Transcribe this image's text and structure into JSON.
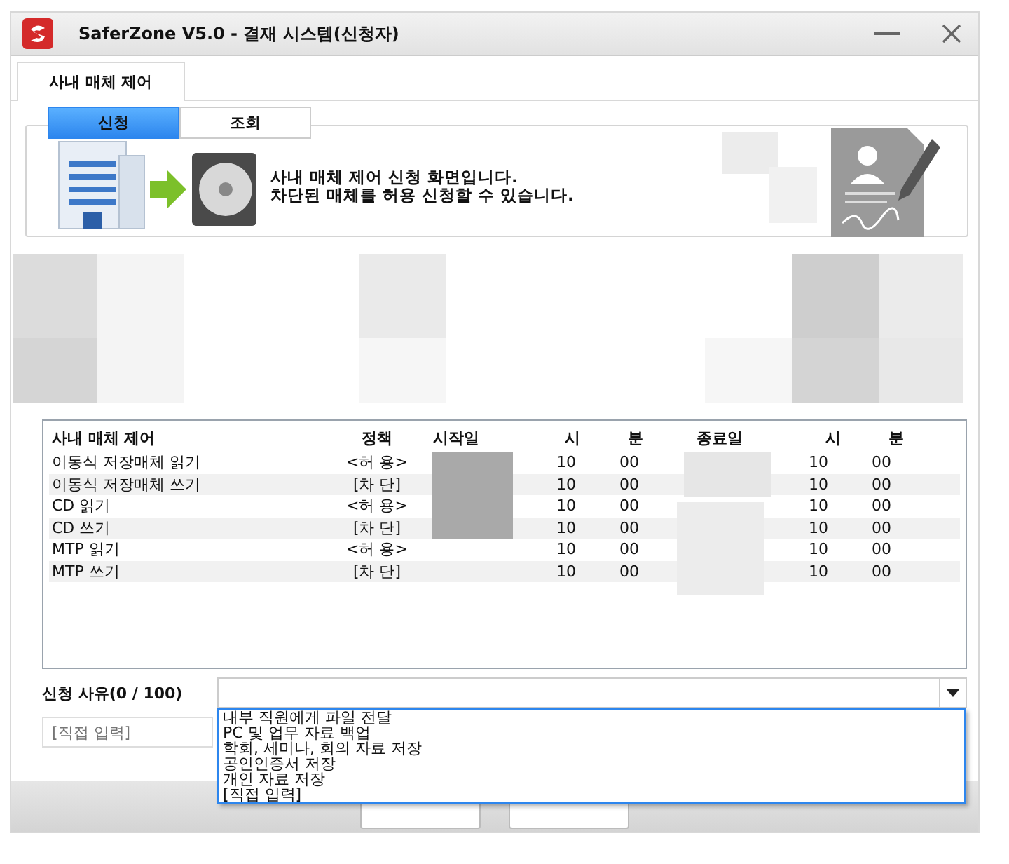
{
  "window": {
    "title": "SaferZone V5.0 - 결재 시스템(신청자)"
  },
  "tabs": [
    {
      "label": "사내 매체 제어",
      "selected": true
    }
  ],
  "subtabs": [
    {
      "label": "신청",
      "selected": true
    },
    {
      "label": "조회",
      "selected": false
    }
  ],
  "banner": {
    "lines": [
      "사내 매체 제어 신청 화면입니다.",
      "차단된 매체를 허용 신청할 수 있습니다."
    ]
  },
  "table": {
    "columns": [
      "사내 매체 제어",
      "정책",
      "시작일",
      "시",
      "분",
      "종료일",
      "시",
      "분"
    ],
    "rows": [
      {
        "name": "이동식 저장매체 읽기",
        "policy": "<허 용>",
        "start_hour": "10",
        "start_min": "00",
        "end_hour": "10",
        "end_min": "00"
      },
      {
        "name": "이동식 저장매체 쓰기",
        "policy": "[차 단]",
        "start_hour": "10",
        "start_min": "00",
        "end_hour": "10",
        "end_min": "00"
      },
      {
        "name": "CD 읽기",
        "policy": "<허 용>",
        "start_hour": "10",
        "start_min": "00",
        "end_hour": "10",
        "end_min": "00"
      },
      {
        "name": "CD 쓰기",
        "policy": "[차 단]",
        "start_hour": "10",
        "start_min": "00",
        "end_hour": "10",
        "end_min": "00"
      },
      {
        "name": "MTP 읽기",
        "policy": "<허 용>",
        "start_hour": "10",
        "start_min": "00",
        "end_hour": "10",
        "end_min": "00"
      },
      {
        "name": "MTP 쓰기",
        "policy": "[차 단]",
        "start_hour": "10",
        "start_min": "00",
        "end_hour": "10",
        "end_min": "00"
      }
    ]
  },
  "reason": {
    "label": "신청 사유(0 / 100)",
    "dropdown": {
      "expanded": true,
      "options": [
        "내부 직원에게 파일 전달",
        "PC 및 업무 자료 백업",
        "학회, 세미나, 회의 자료 저장",
        "공인인증서 저장",
        "개인 자료 저장",
        "[직접 입력]"
      ]
    },
    "custom_input": {
      "placeholder": "[직접 입력]"
    }
  }
}
